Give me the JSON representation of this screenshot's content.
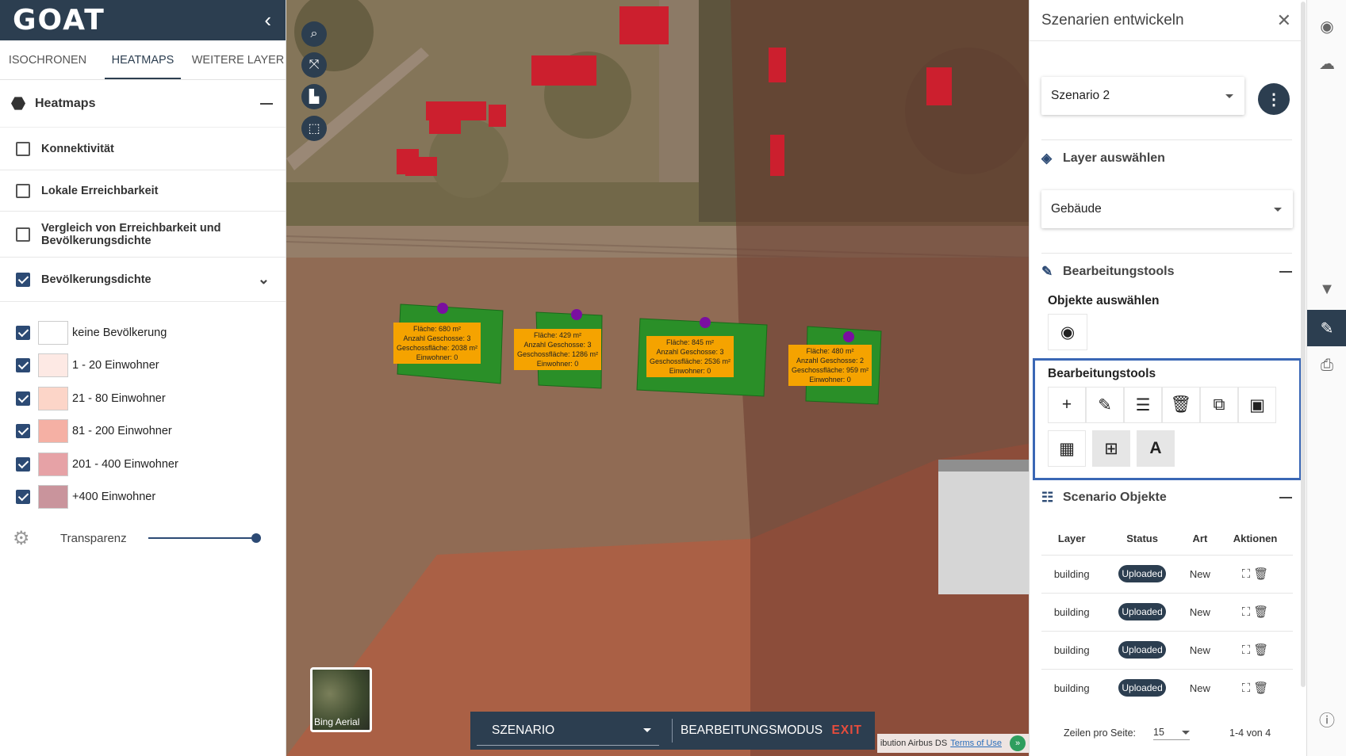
{
  "app": {
    "logo": "GOAT"
  },
  "tabs": [
    "ISOCHRONEN",
    "HEATMAPS",
    "WEITERE LAYER"
  ],
  "heatmaps": {
    "title": "Heatmaps",
    "layers": [
      {
        "label": "Konnektivität",
        "checked": false
      },
      {
        "label": "Lokale Erreichbarkeit",
        "checked": false
      },
      {
        "label": "Vergleich von Erreichbarkeit und Bevölkerungsdichte",
        "checked": false
      },
      {
        "label": "Bevölkerungsdichte",
        "checked": true
      }
    ],
    "legend": [
      {
        "label": "keine Bevölkerung",
        "color": "#ffffff"
      },
      {
        "label": "1 - 20 Einwohner",
        "color": "#fde9e4"
      },
      {
        "label": "21 - 80 Einwohner",
        "color": "#fcd5c8"
      },
      {
        "label": "81 - 200 Einwohner",
        "color": "#f5b0a4"
      },
      {
        "label": "201 - 400 Einwohner",
        "color": "#e6a2a6"
      },
      {
        "label": "+400 Einwohner",
        "color": "#c9949c"
      }
    ],
    "transparency_label": "Transparenz",
    "transparency_value": 1.0
  },
  "map": {
    "buildings": [
      {
        "label": "Fläche: 680 m²\nAnzahl Geschosse: 3\nGeschossfläche: 2038 m²\nEinwohner: 0"
      },
      {
        "label": "Fläche: 429 m²\nAnzahl Geschosse: 3\nGeschossfläche: 1286 m²\nEinwohner: 0"
      },
      {
        "label": "Fläche: 845 m²\nAnzahl Geschosse: 3\nGeschossfläche: 2536 m²\nEinwohner: 0"
      },
      {
        "label": "Fläche: 480 m²\nAnzahl Geschosse: 2\nGeschossfläche: 959 m²\nEinwohner: 0"
      }
    ],
    "basemap_label": "Bing Aerial",
    "scenario_select": "SZENARIO",
    "mode_label": "BEARBEITUNGSMODUS",
    "exit_label": "EXIT",
    "attribution": "ibution Airbus DS",
    "terms_link": "Terms of Use"
  },
  "right": {
    "title": "Szenarien entwickeln",
    "scenario_value": "Szenario 2",
    "layer_section": "Layer auswählen",
    "layer_value": "Gebäude",
    "tools_section": "Bearbeitungstools",
    "select_objects": "Objekte auswählen",
    "edit_tools_label": "Bearbeitungstools",
    "objects_section": "Scenario Objekte",
    "table": {
      "headers": [
        "Layer",
        "Status",
        "Art",
        "Aktionen"
      ],
      "rows": [
        {
          "layer": "building",
          "status": "Uploaded",
          "art": "New"
        },
        {
          "layer": "building",
          "status": "Uploaded",
          "art": "New"
        },
        {
          "layer": "building",
          "status": "Uploaded",
          "art": "New"
        },
        {
          "layer": "building",
          "status": "Uploaded",
          "art": "New"
        }
      ]
    },
    "pager": {
      "rows_label": "Zeilen pro Seite:",
      "rows_value": "15",
      "range": "1-4 von 4"
    }
  }
}
